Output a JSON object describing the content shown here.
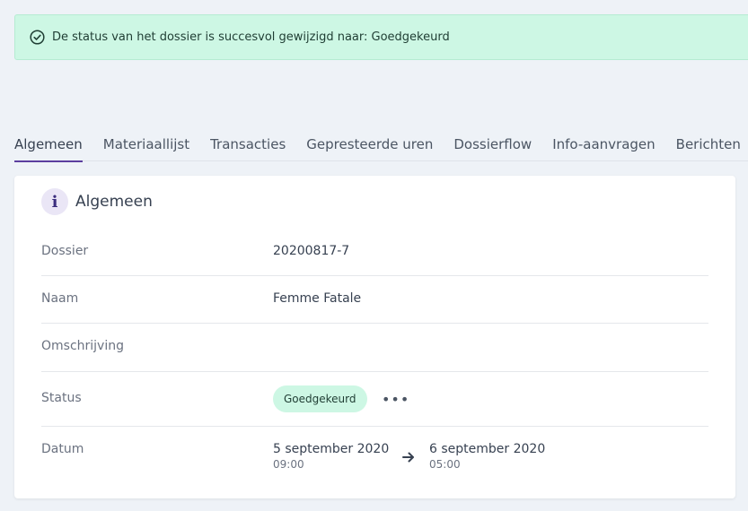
{
  "alert": {
    "message": "De status van het dossier is succesvol gewijzigd naar: Goedgekeurd",
    "icon": "check-circle-icon",
    "color": "#cdf7e4"
  },
  "tabs": [
    {
      "label": "Algemeen",
      "active": true
    },
    {
      "label": "Materiaallijst",
      "active": false
    },
    {
      "label": "Transacties",
      "active": false
    },
    {
      "label": "Gepresteerde uren",
      "active": false
    },
    {
      "label": "Dossierflow",
      "active": false
    },
    {
      "label": "Info-aanvragen",
      "active": false
    },
    {
      "label": "Berichten",
      "active": false
    }
  ],
  "accent_color": "#5b3e9e",
  "card": {
    "title": "Algemeen",
    "icon": "info-icon",
    "icon_glyph": "i",
    "rows": {
      "dossier": {
        "label": "Dossier",
        "value": "20200817-7"
      },
      "naam": {
        "label": "Naam",
        "value": "Femme Fatale"
      },
      "omschrijving": {
        "label": "Omschrijving",
        "value": ""
      },
      "status": {
        "label": "Status",
        "value": "Goedgekeurd",
        "more": "•••"
      },
      "datum": {
        "label": "Datum",
        "start_date": "5 september 2020",
        "start_time": "09:00",
        "end_date": "6 september 2020",
        "end_time": "05:00"
      }
    }
  }
}
